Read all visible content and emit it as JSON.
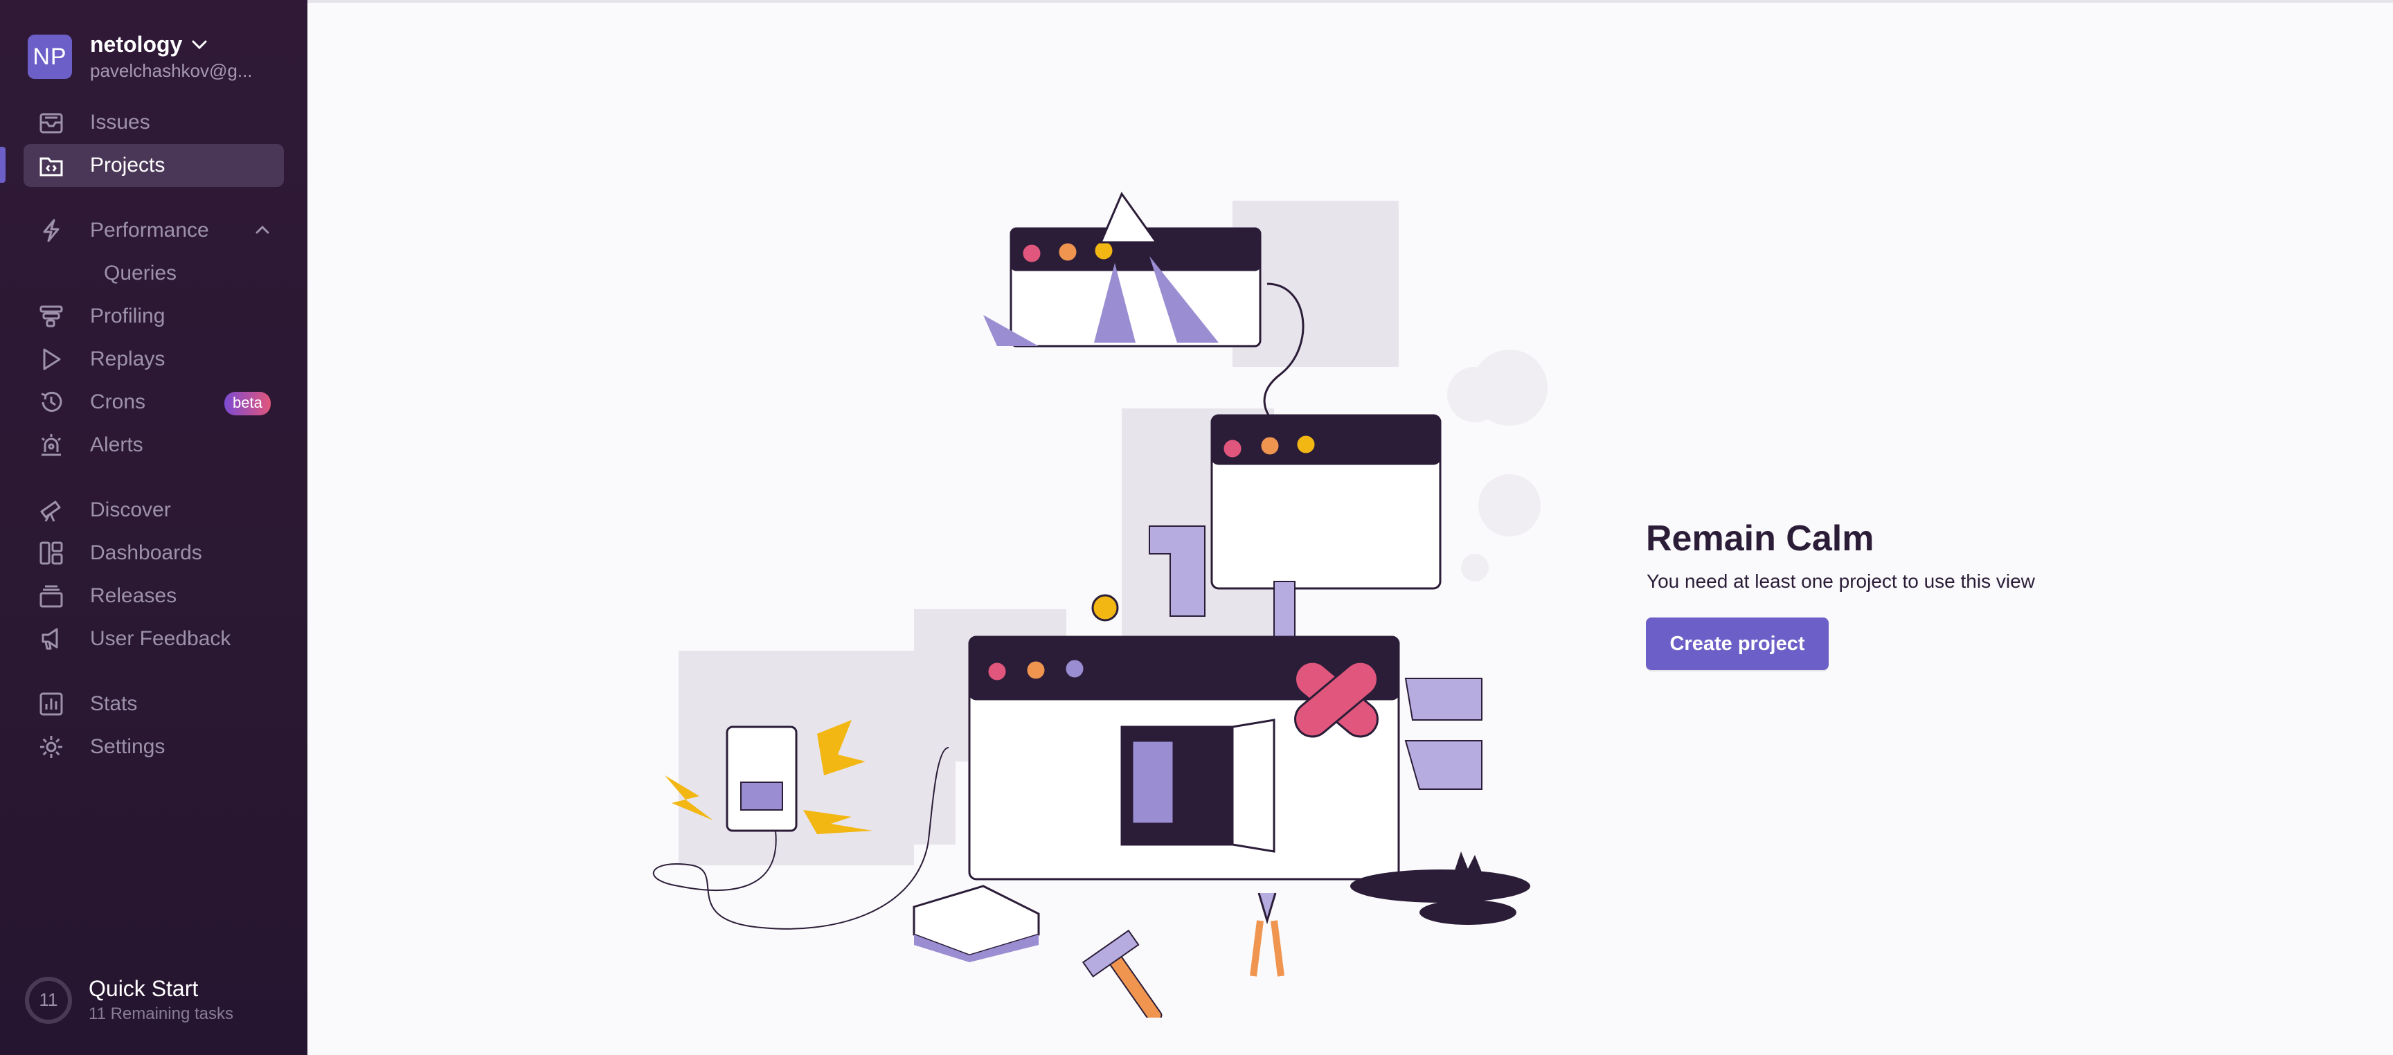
{
  "org": {
    "initials": "NP",
    "name": "netology",
    "email": "pavelchashkov@g..."
  },
  "nav": {
    "issues": "Issues",
    "projects": "Projects",
    "performance": "Performance",
    "queries": "Queries",
    "profiling": "Profiling",
    "replays": "Replays",
    "crons": "Crons",
    "crons_badge": "beta",
    "alerts": "Alerts",
    "discover": "Discover",
    "dashboards": "Dashboards",
    "releases": "Releases",
    "user_feedback": "User Feedback",
    "stats": "Stats",
    "settings": "Settings"
  },
  "quick_start": {
    "count": "11",
    "title": "Quick Start",
    "subtitle": "11 Remaining tasks"
  },
  "empty_state": {
    "title": "Remain Calm",
    "message": "You need at least one project to use this view",
    "button": "Create project"
  },
  "colors": {
    "sidebar_bg": "#2f1937",
    "accent": "#6c5fc7",
    "badge_from": "#7c4bd1",
    "badge_to": "#e1567c"
  }
}
